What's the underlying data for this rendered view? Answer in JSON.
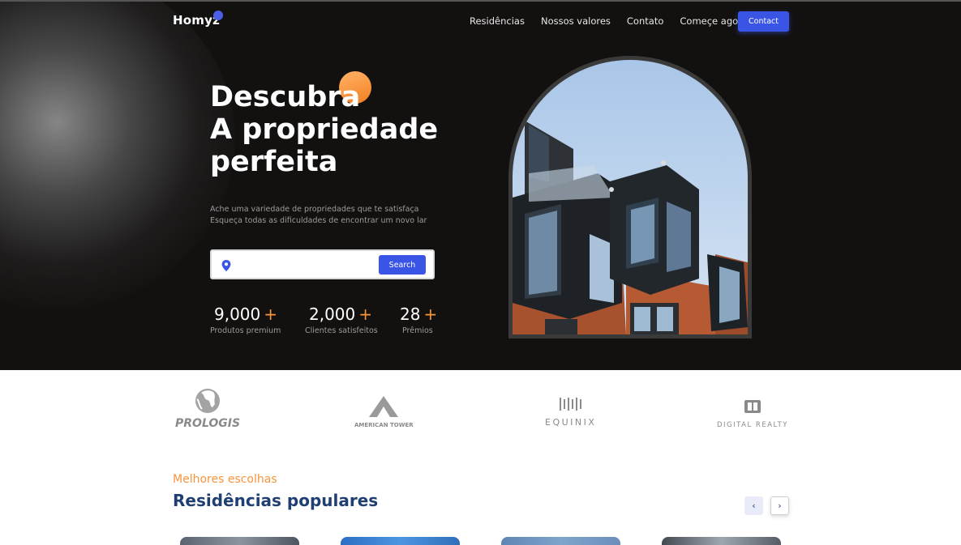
{
  "header": {
    "logo": "Homyz",
    "nav": [
      "Residências",
      "Nossos valores",
      "Contato",
      "Começe agora"
    ],
    "contact_button": "Contact"
  },
  "hero": {
    "title_lines": [
      "Descubra",
      "A propriedade",
      "perfeita"
    ],
    "description_lines": [
      "Ache uma variedade de propriedades que te satisfaça",
      "Esqueça todas as dificuldades de encontrar um novo lar"
    ],
    "search": {
      "value": "",
      "button": "Search"
    },
    "stats": [
      {
        "value": "9,000",
        "plus": "+",
        "label": "Produtos premium"
      },
      {
        "value": "2,000",
        "plus": "+",
        "label": "Clientes satisfeitos"
      },
      {
        "value": "28",
        "plus": "+",
        "label": "Prêmios"
      }
    ]
  },
  "partners": [
    {
      "name": "PROLOGIS",
      "suffix": ".",
      "icon": "globe-logo-icon"
    },
    {
      "name": "AMERICAN TOWER",
      "icon": "tower-logo-icon"
    },
    {
      "name": "EQUINIX",
      "icon": "equinix-logo-icon"
    },
    {
      "name": "DIGITAL REALTY",
      "icon": "digital-realty-logo-icon"
    }
  ],
  "residences": {
    "subtitle": "Melhores escolhas",
    "title": "Residências populares",
    "prev_icon": "chevron-left-icon",
    "prev_label": "‹",
    "next_icon": "chevron-right-icon",
    "next_label": "›"
  },
  "colors": {
    "accent": "#3a55e6",
    "orange": "#f8943c",
    "navy": "#1f3e72",
    "hero_bg": "#131110"
  }
}
